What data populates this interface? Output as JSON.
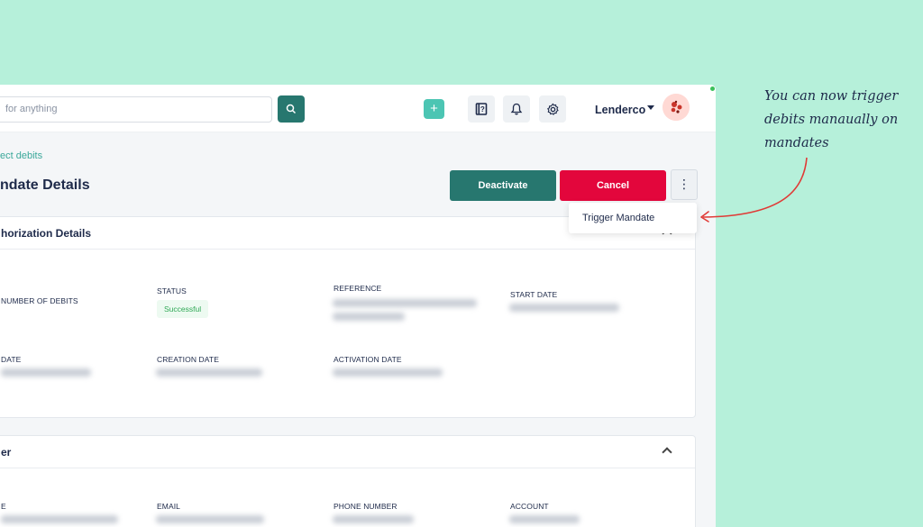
{
  "header": {
    "search_placeholder": "Search for anything",
    "search_visible_text": "for anything",
    "org_name": "Lenderco",
    "plus_label": "+"
  },
  "page": {
    "breadcrumb": "ect debits",
    "title": "ndate Details"
  },
  "actions": {
    "deactivate_label": "Deactivate",
    "cancel_label": "Cancel",
    "more_label": "⋮",
    "menu_items": [
      "Trigger Mandate"
    ]
  },
  "auth_card": {
    "title": "horization Details",
    "fields": {
      "num_debits_label": "NUMBER OF DEBITS",
      "status_label": "STATUS",
      "status_value": "Successful",
      "reference_label": "REFERENCE",
      "start_date_label": "START DATE",
      "date_label": "DATE",
      "creation_date_label": "CREATION DATE",
      "activation_date_label": "ACTIVATION DATE"
    }
  },
  "customer_card": {
    "title": "er",
    "fields": {
      "e_label": "E",
      "email_label": "EMAIL",
      "phone_label": "PHONE NUMBER",
      "account_label": "ACCOUNT"
    }
  },
  "annotation": {
    "lines": [
      "You can now trigger",
      "debits manaually on",
      "mandates"
    ]
  },
  "colors": {
    "background": "#b6f0da",
    "primary": "#27776f",
    "danger": "#e3063c",
    "accent": "#4cc5b3",
    "success": "#2fa855"
  },
  "icons": [
    "search-icon",
    "plus-icon",
    "help-book-icon",
    "bell-icon",
    "gear-icon",
    "caret-down-icon",
    "chevron-up-icon",
    "kebab-menu-icon",
    "arrow-pointer-icon"
  ]
}
